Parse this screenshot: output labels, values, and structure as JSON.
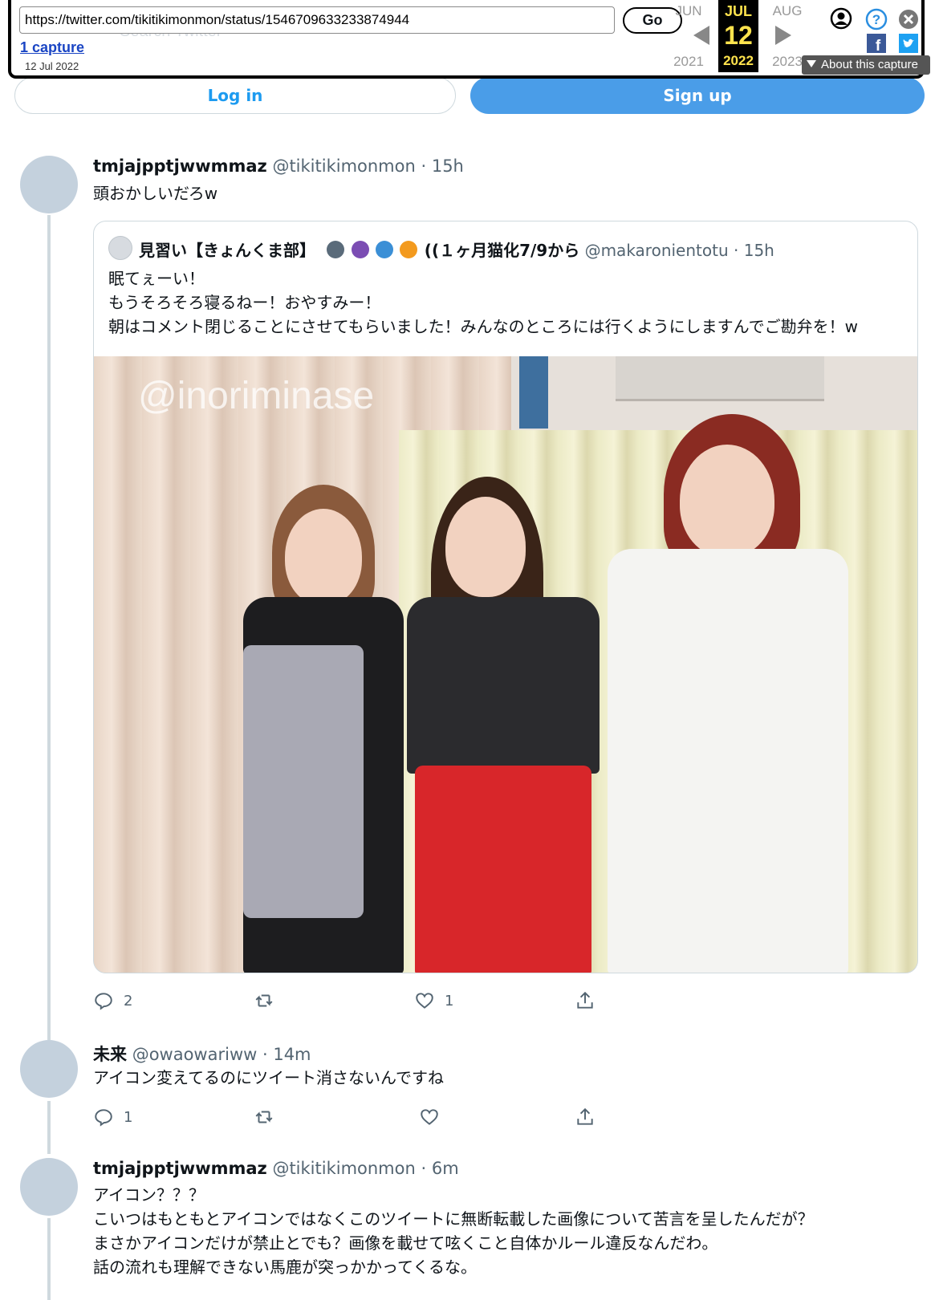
{
  "wayback": {
    "url": "https://twitter.com/tikitikimonmon/status/1546709633233874944",
    "go_label": "Go",
    "captures_label": "1 capture",
    "capture_date": "12 Jul 2022",
    "ghost_search": "Search Twitter",
    "prev_month": "JUN",
    "cur_month": "JUL",
    "next_month": "AUG",
    "cur_day": "12",
    "prev_year": "2021",
    "cur_year": "2022",
    "next_year": "2023",
    "about_label": "About this capture"
  },
  "auth": {
    "login_label": "Log in",
    "signup_label": "Sign up"
  },
  "main_tweet": {
    "name": "tmjajpptjwwmmaz",
    "handle": "@tikitikimonmon",
    "time": "· 15h",
    "text": "頭おかしいだろw",
    "quote": {
      "name": "見習い【きょんくま部】",
      "name_suffix": "((１ヶ月猫化7/9から",
      "handle": "@makaronientotu",
      "time": "· 15h",
      "lines": [
        "眠てぇーい！",
        "もうそろそろ寝るねー！おやすみー！",
        "朝はコメント閉じることにさせてもらいました！みんなのところには行くようにしますんでご勘弁を！w"
      ],
      "image_watermark": "@inoriminase"
    },
    "reply_count": "2",
    "retweet_count": "",
    "like_count": "1"
  },
  "reply1": {
    "name": "未来",
    "handle": "@owaowariww",
    "time": "· 14m",
    "text": "アイコン変えてるのにツイート消さないんですね",
    "reply_count": "1",
    "retweet_count": "",
    "like_count": ""
  },
  "reply2": {
    "name": "tmjajpptjwwmmaz",
    "handle": "@tikitikimonmon",
    "time": "· 6m",
    "lines": [
      "アイコン？？？",
      "こいつはもともとアイコンではなくこのツイートに無断転載した画像について苦言を呈したんだが？",
      "まさかアイコンだけが禁止とでも？画像を載せて呟くこと自体かルール違反なんだわ。",
      "話の流れも理解できない馬鹿が突っかかってくるな。"
    ]
  },
  "colors": {
    "accent": "#1d9bf0",
    "signup_bg": "#4a9de8",
    "muted_text": "#536471",
    "avatar": "#c4d1dd",
    "wayback_highlight": "#ffe34d"
  },
  "icons": [
    "reply-icon",
    "retweet-icon",
    "like-icon",
    "share-icon",
    "user-icon",
    "help-icon",
    "close-icon",
    "facebook-icon",
    "twitter-icon"
  ]
}
